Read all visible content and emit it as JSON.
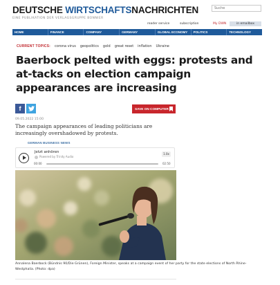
{
  "header": {
    "logo_part1": "DEUTSCHE ",
    "logo_part2": "WIRTSCHAFTS",
    "logo_part3": "NACHRICHTEN",
    "logo_sub": "EINE PUBLIKATION DER VERLAGSGRUPPE BONNIER",
    "search_placeholder": "Suche",
    "reader_service": "reader service",
    "subscription": "subscription",
    "my_dwn": "My DWN",
    "emailbox": "in emailbox"
  },
  "nav": {
    "items": [
      "HOME",
      "FINANCE",
      "COMPANY",
      "GERMANY",
      "GLOBAL ECONOMY",
      "POLITICS",
      "TECHNOLOGY"
    ]
  },
  "topics": {
    "label": "CURRENT TOPICS:",
    "items": [
      "corona virus",
      "geopolitics",
      "gold",
      "great reset",
      "inflation",
      "Ukraine"
    ]
  },
  "article": {
    "headline": "Baerbock pelted with eggs: protests and at-tacks on election campaign appearances are increasing",
    "save_label": "SAVE ON COMPUTER",
    "date": "09.05.2022 15:00",
    "lead": "The campaign appearances of leading politicians are increasingly overshadowed by protests.",
    "source": "GERMAN BUSINESS NEWS",
    "caption": "Annalena Baerbock (Bündnis 90/Die Grünen), Foreign Minister, speaks at a campaign event of her party for the state elections of North Rhine-Westphalia. (Photo: dpa)"
  },
  "player": {
    "title": "Jetzt anhören",
    "powered": "Powered by Trinity Audio",
    "speed": "1.0x",
    "time_start": "00:00",
    "time_end": "02:50",
    "progress": 0.0
  },
  "colors": {
    "nav_bg": "#1f5a9a",
    "accent_red": "#c8262c",
    "facebook": "#3b5998",
    "twitter": "#3fa4e0"
  },
  "icons": {
    "facebook": "facebook-icon",
    "twitter": "twitter-icon",
    "save": "bookmark-icon",
    "play": "play-icon"
  }
}
